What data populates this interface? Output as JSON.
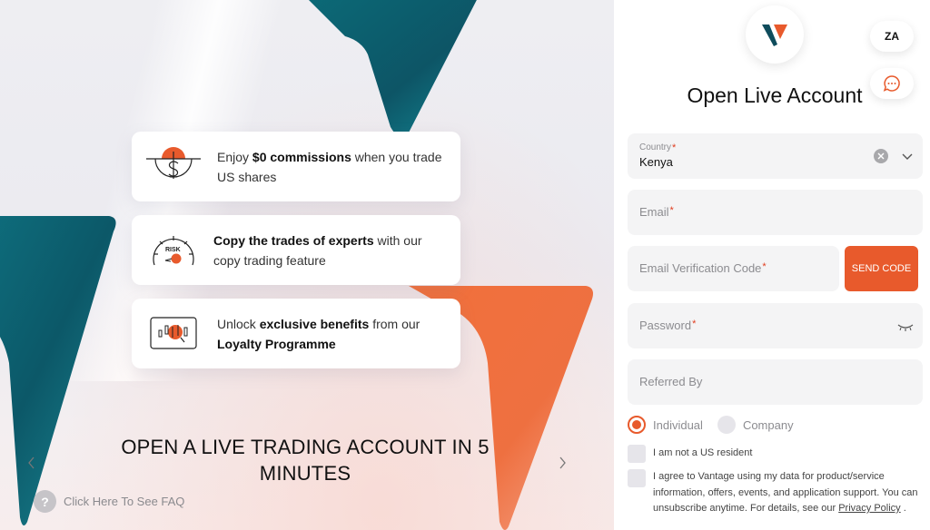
{
  "hero": {
    "features": [
      {
        "icon": "dollar-coin-icon",
        "pre": "Enjoy ",
        "bold": "$0 commissions",
        "post": " when you trade US shares"
      },
      {
        "icon": "risk-gauge-icon",
        "pre": "",
        "bold": "Copy the trades of experts",
        "post": " with our copy trading feature"
      },
      {
        "icon": "candlestick-chart-icon",
        "pre": "Unlock ",
        "bold": "exclusive benefits",
        "post": " from our ",
        "bold2": "Loyalty Programme"
      }
    ],
    "headline": "OPEN A LIVE TRADING ACCOUNT IN 5 MINUTES",
    "faq_label": "Click Here To See FAQ",
    "faq_icon": "?"
  },
  "header": {
    "language": "ZA",
    "title": "Open Live Account"
  },
  "form": {
    "country": {
      "label": "Country",
      "required": "*",
      "value": "Kenya"
    },
    "email": {
      "placeholder": "Email",
      "required": "*"
    },
    "verification_code": {
      "placeholder": "Email Verification Code",
      "required": "*"
    },
    "send_code_label": "SEND CODE",
    "password": {
      "placeholder": "Password",
      "required": "*"
    },
    "referred_by": {
      "placeholder": "Referred By"
    },
    "account_type": {
      "options": [
        "Individual",
        "Company"
      ],
      "selected": "Individual"
    },
    "checkbox_us": {
      "label": "I am not a US resident",
      "checked": false
    },
    "checkbox_consent": {
      "label": "I agree to Vantage using my data for product/service information, offers, events, and application support. You can unsubscribe anytime. For details, see our ",
      "link": "Privacy Policy",
      "suffix": " .",
      "checked": false
    }
  },
  "colors": {
    "accent": "#e85a2c",
    "teal": "#0f5f6e",
    "field_bg": "#f4f4f5"
  }
}
